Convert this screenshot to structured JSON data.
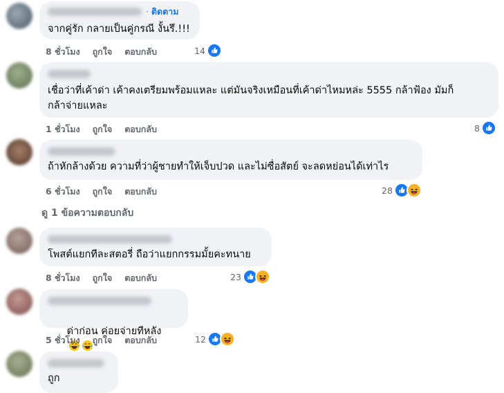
{
  "comments": [
    {
      "text": "จากคู่รัก กลายเป็นคู่กรณี งั้นรึ.!!!",
      "follow": "ติดตาม",
      "time": "8 ชั่วโมง",
      "like": "ถูกใจ",
      "reply": "ตอบกลับ",
      "reaction_count": "14",
      "reactions": [
        "like"
      ]
    },
    {
      "text": "เชื่อว่าที่เค้าด่า เค้าคงเตรียมพร้อมแหละ แต่มันจริงเหมือนที่เค้าด่าไหมหล่ะ 5555 กล้าฟ้อง มัมก็\nกล้าจ่ายแหละ",
      "time": "1 ชั่วโมง",
      "like": "ถูกใจ",
      "reply": "ตอบกลับ",
      "reaction_count": "8",
      "reactions": [
        "like"
      ]
    },
    {
      "text": "ถ้าหักล้างด้วย ความที่ว่าผู้ชายทำให้เจ็บปวด และไม่ซื่อสัตย์ จะลดหย่อนได้เท่าไร",
      "time": "6 ชั่วโมง",
      "like": "ถูกใจ",
      "reply": "ตอบกลับ",
      "reaction_count": "28",
      "reactions": [
        "like",
        "haha"
      ]
    },
    {
      "text": "โพสต์แยกทีละสตอรี่ ถือว่าแยกกรรมมั้ยคะทนาย",
      "time": "8 ชั่วโมง",
      "like": "ถูกใจ",
      "reply": "ตอบกลับ",
      "reaction_count": "23",
      "reactions": [
        "like",
        "haha"
      ]
    },
    {
      "text": "ด่าก่อน ค่อยจ่ายทีหลัง",
      "time": "5 ชั่วโมง",
      "like": "ถูกใจ",
      "reply": "ตอบกลับ",
      "reaction_count": "12",
      "reactions": [
        "like",
        "haha"
      ]
    },
    {
      "text": "ถูก"
    }
  ],
  "view_replies": "ดู 1 ข้อความตอบกลับ",
  "colors": {
    "bubble": "#f0f2f5",
    "meta_text": "#65676b",
    "like_blue": "#1877f2",
    "follow_blue": "#1b74e4",
    "haha_yellow": "#f7b125"
  },
  "icons": {
    "like": "thumbs-up-icon",
    "haha": "laughing-face-icon",
    "inline_emoji": "tears-of-joy-emoji-icon"
  }
}
